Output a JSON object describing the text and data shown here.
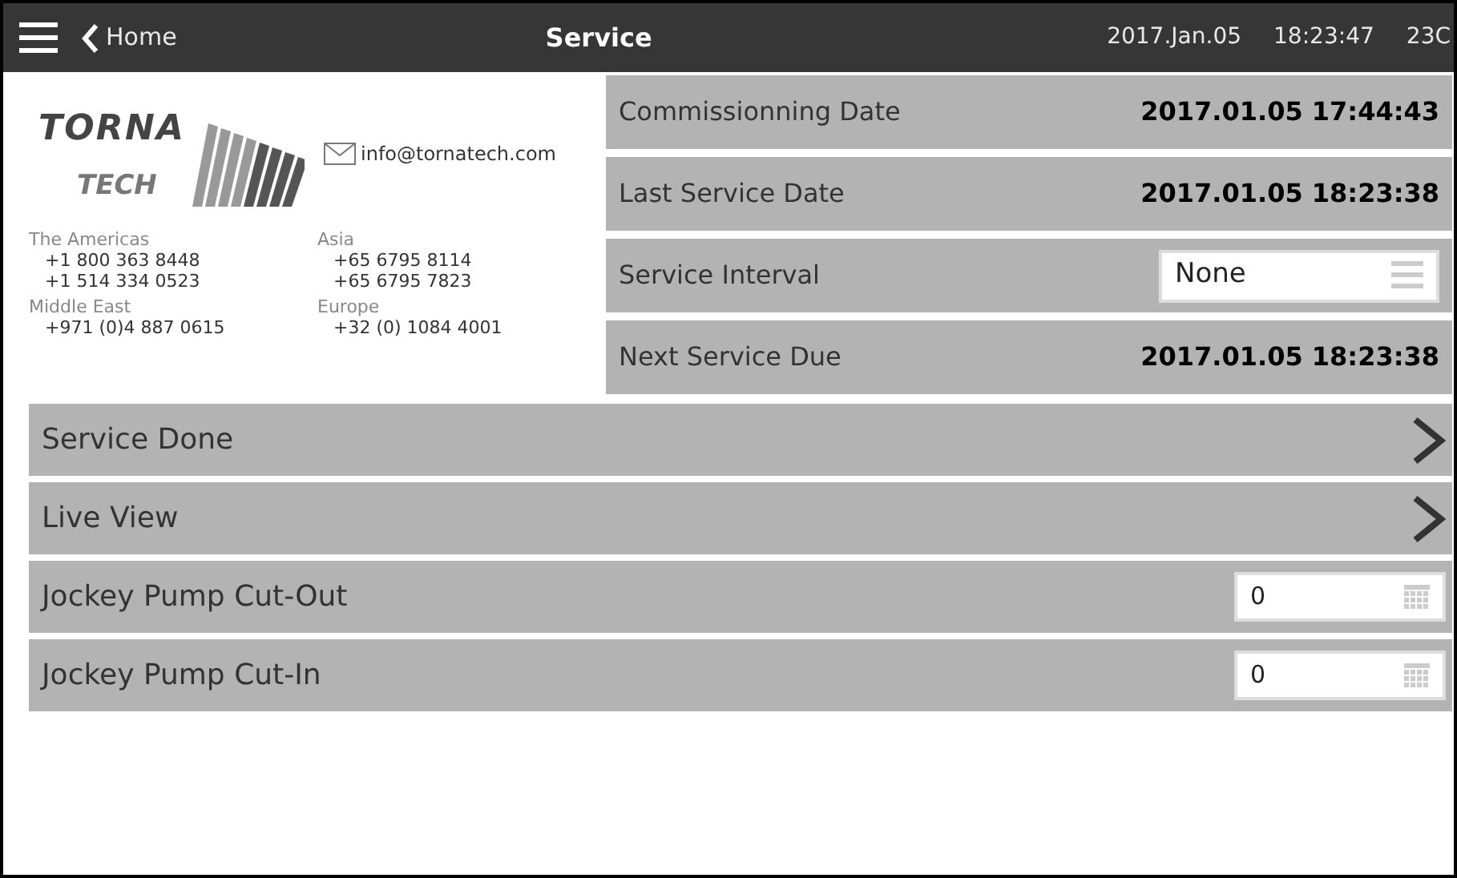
{
  "header": {
    "back": "Home",
    "title": "Service",
    "date": "2017.Jan.05",
    "time": "18:23:47",
    "temperature": "23C"
  },
  "contact": {
    "logo_top": "TORNA",
    "logo_bottom": "TECH",
    "email": "info@tornatech.com",
    "regions": [
      {
        "name": "The Americas",
        "phones": [
          "+1 800 363 8448",
          "+1 514 334 0523"
        ]
      },
      {
        "name": "Asia",
        "phones": [
          "+65 6795 8114",
          "+65 6795 7823"
        ]
      },
      {
        "name": "Middle East",
        "phones": [
          "+971 (0)4 887 0615"
        ]
      },
      {
        "name": "Europe",
        "phones": [
          "+32 (0) 1084 4001"
        ]
      }
    ]
  },
  "info_rows": [
    {
      "kind": "value",
      "label": "Commissionning Date",
      "value": "2017.01.05 17:44:43"
    },
    {
      "kind": "value",
      "label": "Last Service Date",
      "value": "2017.01.05 18:23:38"
    },
    {
      "kind": "select",
      "label": "Service Interval",
      "value": "None"
    },
    {
      "kind": "value",
      "label": "Next Service Due",
      "value": "2017.01.05 18:23:38"
    }
  ],
  "rows": [
    {
      "kind": "link",
      "label": "Service Done"
    },
    {
      "kind": "link",
      "label": "Live View"
    },
    {
      "kind": "number",
      "label": "Jockey Pump Cut-Out",
      "value": "0"
    },
    {
      "kind": "number",
      "label": "Jockey Pump Cut-In",
      "value": "0"
    }
  ]
}
